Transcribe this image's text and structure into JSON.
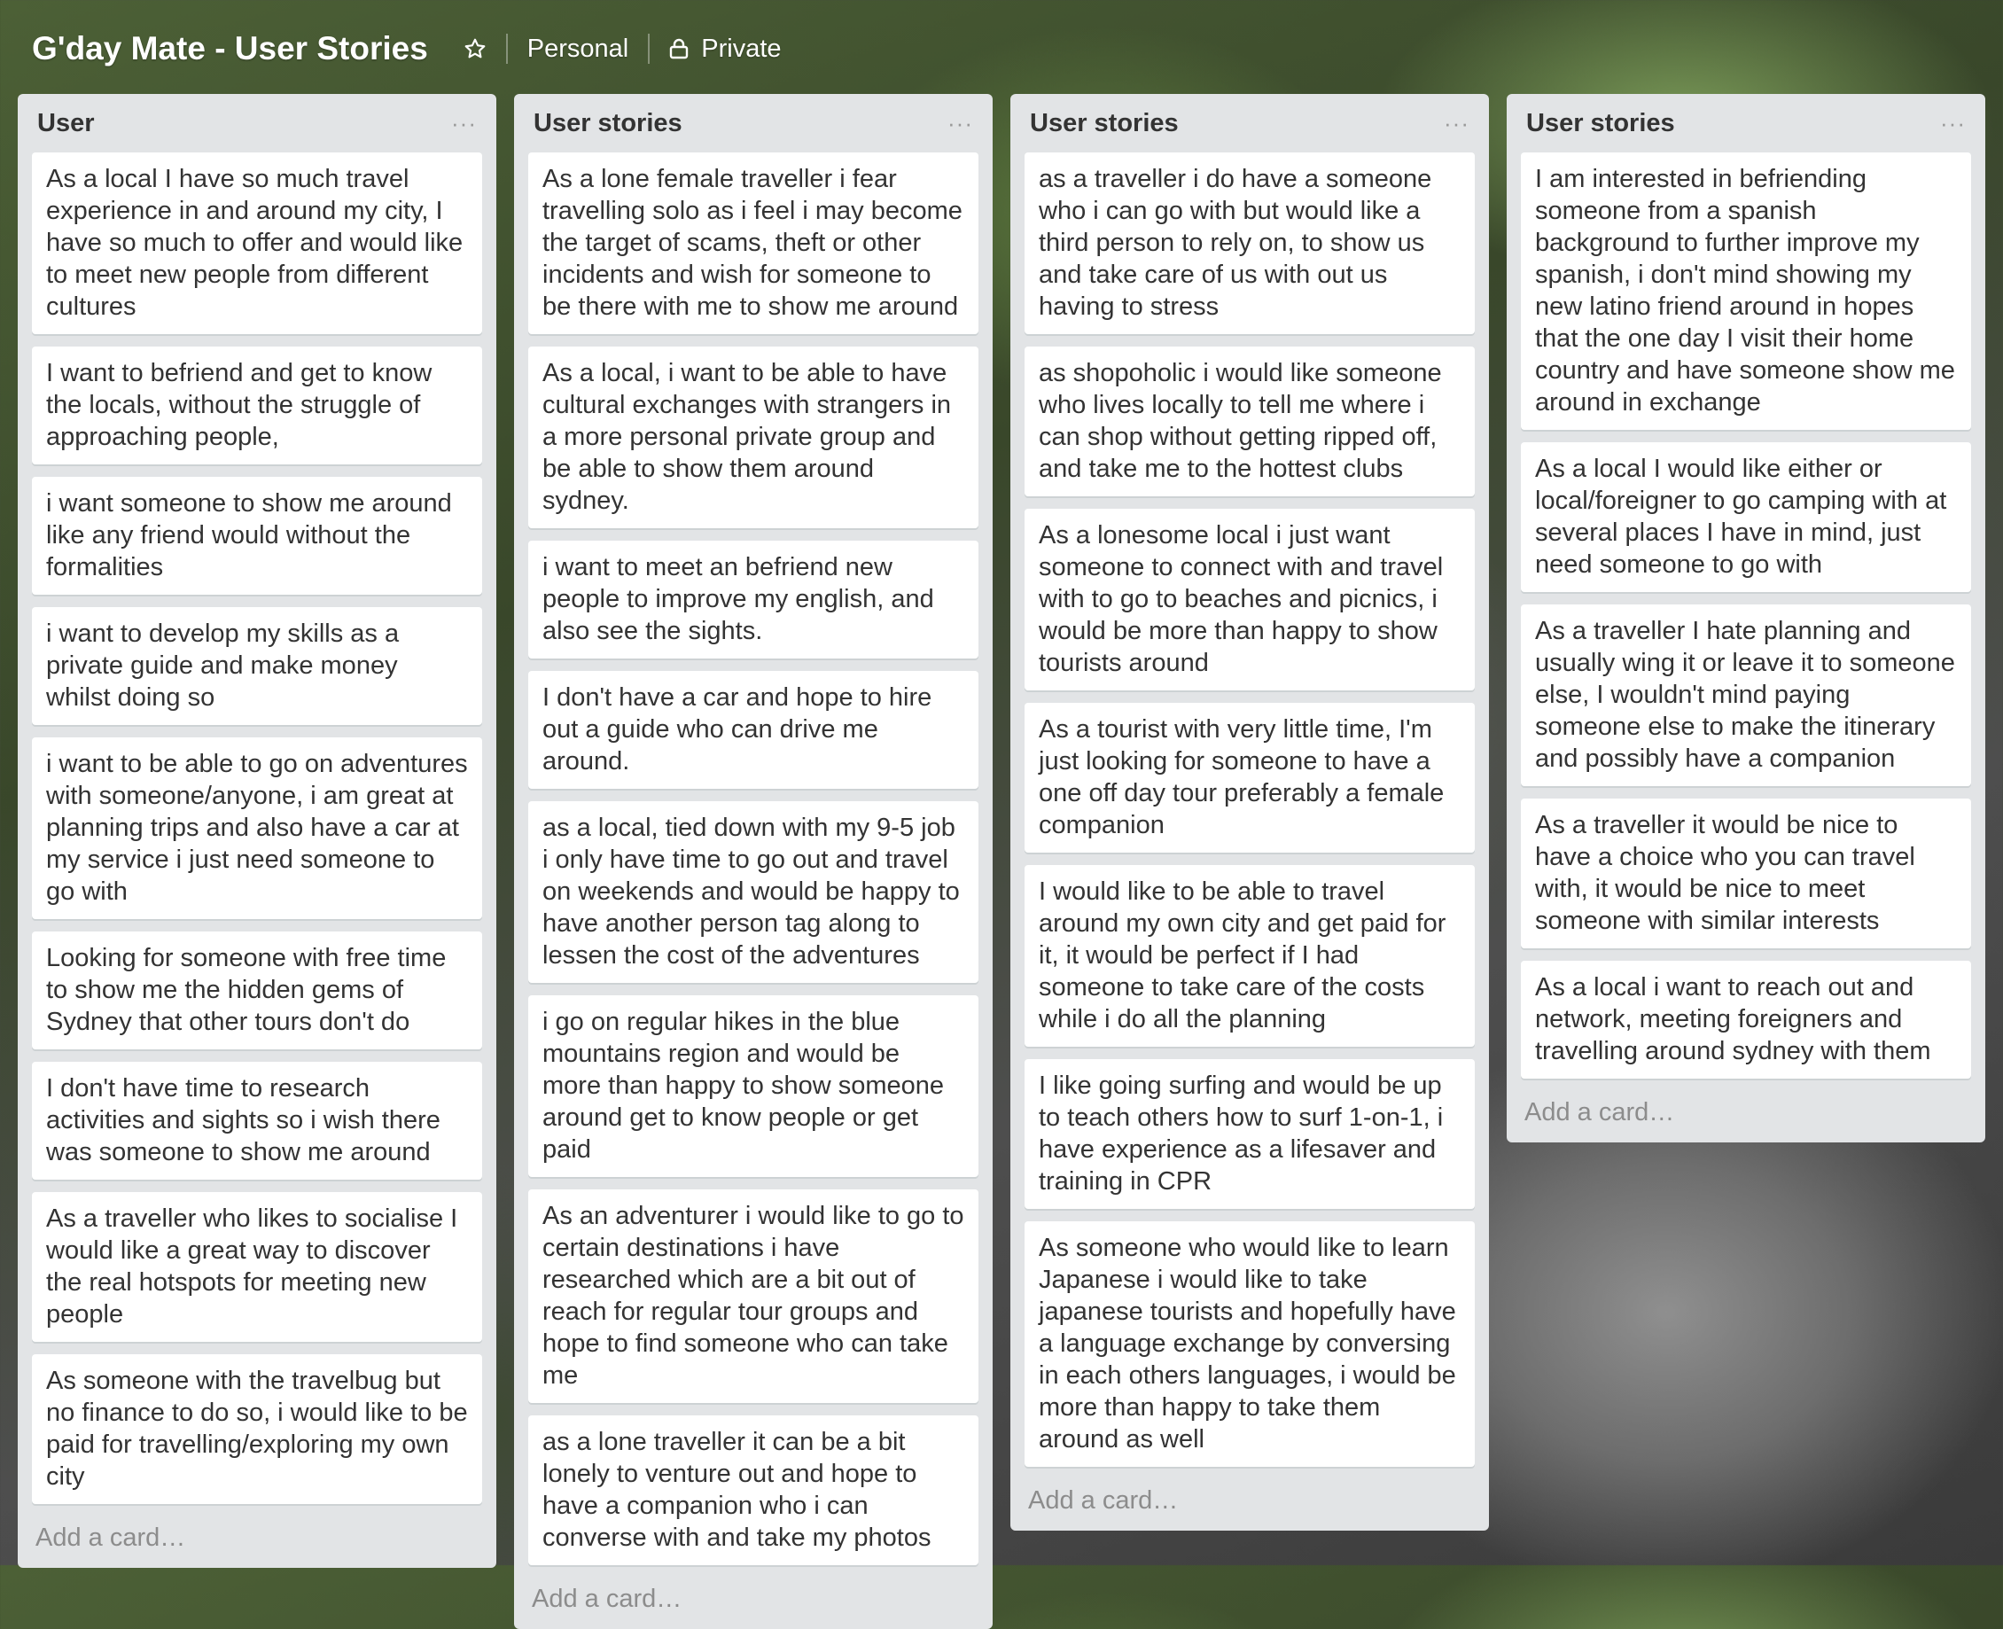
{
  "board": {
    "title": "G'day Mate - User Stories",
    "team_label": "Personal",
    "visibility_label": "Private"
  },
  "add_card_label": "Add a card…",
  "lists": [
    {
      "title": "User",
      "cards": [
        "As a local I have so much travel experience in and around my city, I have so much to offer and would like to meet new people from different cultures",
        "I want to befriend and get to know the locals, without the struggle of approaching people,",
        "i want someone to show me around like any friend would without the formalities",
        "i want to develop my skills as a private guide and make money whilst doing so",
        "i want to be able to go on adventures with someone/anyone, i am great at planning trips and also have a car at my service i just need someone to go with",
        "Looking for someone with free time to show me the hidden gems of Sydney that other tours don't do",
        "I don't have time to research activities and sights so i wish there was someone to show me around",
        "As a traveller who likes to socialise I would like a great way to discover the real hotspots for meeting new people",
        "As someone with the travelbug but no finance to do so, i would like to be paid for travelling/exploring my own city"
      ]
    },
    {
      "title": "User stories",
      "cards": [
        "As a lone female traveller i fear travelling solo as i feel i may become the target of scams, theft or other incidents and wish for someone to be there with me to show me around",
        "As a local, i want to be able to have cultural exchanges with strangers in a more personal private group and be able to show them around sydney.",
        "i want to meet an befriend new people to improve my english, and also see the sights.",
        "I don't have a car and hope to hire out a guide who can drive me around.",
        "as a local, tied down with my 9-5 job i only have time to go out and travel on weekends and would be happy to have another person tag along to lessen the cost of the adventures",
        "i go on regular hikes in the blue mountains region and would be more than happy to show someone around get to know people or get paid",
        "As an adventurer i would like to go to certain destinations i have researched which are a bit out of reach for regular tour groups and hope to find someone who can take me",
        "as a lone traveller it can be a bit lonely to venture out and hope to have a companion who i can converse with and take my photos"
      ]
    },
    {
      "title": "User stories",
      "cards": [
        "as a traveller i do have a someone who i can go with but would like a third person to rely on, to show us and take care of us with out us having to stress",
        "as shopoholic i would like someone who lives locally to tell me where i can shop without getting ripped off, and take me to the hottest clubs",
        "As a lonesome local i just want someone to connect with and travel with to go to beaches and picnics, i would be more than happy to show tourists around",
        "As a tourist with very little time, I'm just looking for someone to have a one off day tour preferably a female companion",
        "I would like to be able to travel around my own city and get paid for it, it would be perfect if I had someone to take care of the costs while i do all the planning",
        "I like going surfing and would be up to teach others how to surf 1-on-1, i have experience as a lifesaver and training in CPR",
        "As someone who would like to learn Japanese i would like to take japanese tourists and hopefully have a language exchange by conversing in each others languages, i would be more than happy to take them around as well"
      ]
    },
    {
      "title": "User stories",
      "cards": [
        "I am interested in befriending someone from a spanish background to further improve my spanish, i don't mind showing my new latino friend around in hopes that the one day I visit their home country and have someone show me around in exchange",
        "As a local I would like either or local/foreigner to go camping with at several places I have in mind, just need someone to go with",
        "As a traveller I hate planning and usually wing it or leave it to someone else, I wouldn't mind paying someone else to make the itinerary and possibly have a companion",
        "As a traveller it would be nice to have a choice who you can travel with, it would be nice to meet someone with similar interests",
        "As a local i want to reach out and network, meeting foreigners and travelling around sydney with them"
      ]
    }
  ]
}
